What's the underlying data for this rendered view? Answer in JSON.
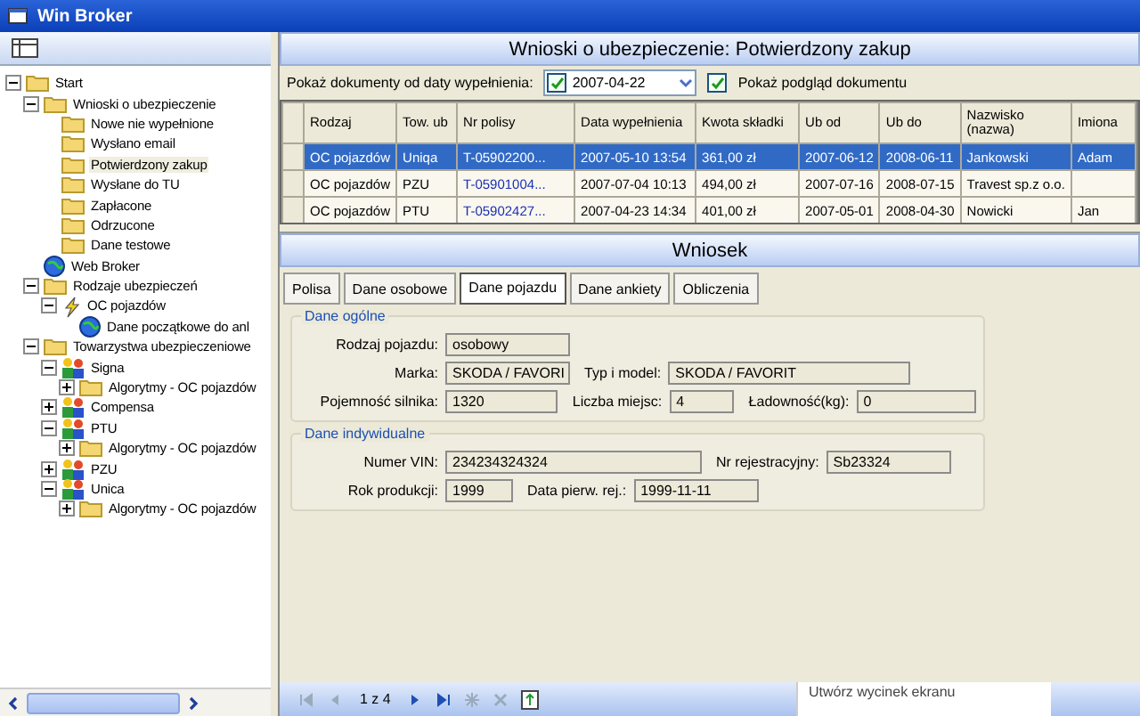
{
  "window": {
    "title": "Win Broker"
  },
  "tree": [
    {
      "label": "Start",
      "kind": "folder",
      "expanded": true,
      "selected": false,
      "children": [
        {
          "label": "Wnioski o ubezpieczenie",
          "kind": "folder",
          "expanded": true,
          "selected": false,
          "children": [
            {
              "label": "Nowe nie wypełnione",
              "kind": "folder",
              "selected": false
            },
            {
              "label": "Wysłano email",
              "kind": "folder",
              "selected": false
            },
            {
              "label": "Potwierdzony zakup",
              "kind": "folder",
              "selected": true
            },
            {
              "label": "Wysłane do TU",
              "kind": "folder",
              "selected": false
            },
            {
              "label": "Zapłacone",
              "kind": "folder",
              "selected": false
            },
            {
              "label": "Odrzucone",
              "kind": "folder",
              "selected": false
            },
            {
              "label": "Dane testowe",
              "kind": "folder",
              "selected": false
            }
          ]
        },
        {
          "label": "Web Broker",
          "kind": "globe",
          "selected": false
        },
        {
          "label": "Rodzaje ubezpieczeń",
          "kind": "folder",
          "expanded": true,
          "selected": false,
          "children": [
            {
              "label": "OC pojazdów",
              "kind": "bolt",
              "expanded": true,
              "selected": false,
              "children": [
                {
                  "label": "Dane początkowe do anl",
                  "kind": "globe",
                  "selected": false
                }
              ]
            }
          ]
        },
        {
          "label": "Towarzystwa ubezpieczeniowe",
          "kind": "folder",
          "expanded": true,
          "selected": false,
          "children": [
            {
              "label": "Signa",
              "kind": "company",
              "expanded": true,
              "selected": false,
              "children": [
                {
                  "label": "Algorytmy - OC pojazdów",
                  "kind": "folder",
                  "expanded": false,
                  "selected": false
                }
              ]
            },
            {
              "label": "Compensa",
              "kind": "company",
              "expanded": false,
              "selected": false
            },
            {
              "label": "PTU",
              "kind": "company",
              "expanded": true,
              "selected": false,
              "children": [
                {
                  "label": "Algorytmy - OC pojazdów",
                  "kind": "folder",
                  "expanded": false,
                  "selected": false
                }
              ]
            },
            {
              "label": "PZU",
              "kind": "company",
              "expanded": false,
              "selected": false
            },
            {
              "label": "Unica",
              "kind": "company",
              "expanded": true,
              "selected": false,
              "children": [
                {
                  "label": "Algorytmy - OC pojazdów",
                  "kind": "folder",
                  "expanded": false,
                  "selected": false
                }
              ]
            }
          ]
        }
      ]
    }
  ],
  "list_header": {
    "title": "Wnioski o ubezpieczenie: Potwierdzony zakup"
  },
  "filter": {
    "label": "Pokaż dokumenty od daty wypełnienia:",
    "date": {
      "checked": true,
      "value": "2007-04-22"
    },
    "preview": {
      "checked": true,
      "label": "Pokaż podgląd dokumentu"
    }
  },
  "table": {
    "columns": [
      "Rodzaj",
      "Tow. ub",
      "Nr polisy",
      "Data wypełnienia",
      "Kwota składki",
      "Ub od",
      "Ub do",
      "Nazwisko (nazwa)",
      "Imiona"
    ],
    "rows": [
      {
        "selected": true,
        "cells": [
          "OC pojazdów",
          "Uniqa",
          "T-05902200...",
          "2007-05-10 13:54",
          "361,00 zł",
          "2007-06-12",
          "2008-06-11",
          "Jankowski",
          "Adam"
        ]
      },
      {
        "selected": false,
        "cells": [
          "OC pojazdów",
          "PZU",
          "T-05901004...",
          "2007-07-04 10:13",
          "494,00 zł",
          "2007-07-16",
          "2008-07-15",
          "Travest sp.z o.o.",
          ""
        ]
      },
      {
        "selected": false,
        "cells": [
          "OC pojazdów",
          "PTU",
          "T-05902427...",
          "2007-04-23 14:34",
          "401,00 zł",
          "2007-05-01",
          "2008-04-30",
          "Nowicki",
          "Jan"
        ]
      }
    ]
  },
  "detail_header": {
    "title": "Wniosek"
  },
  "tabs": [
    {
      "label": "Polisa",
      "selected": false
    },
    {
      "label": "Dane osobowe",
      "selected": false
    },
    {
      "label": "Dane pojazdu",
      "selected": true
    },
    {
      "label": "Dane ankiety",
      "selected": false
    },
    {
      "label": "Obliczenia",
      "selected": false
    }
  ],
  "groups": [
    {
      "title": "Dane ogólne",
      "rows": [
        [
          {
            "label": "Rodzaj pojazdu:",
            "value": "osobowy"
          }
        ],
        [
          {
            "label": "Marka:",
            "value": "SKODA / FAVORI"
          },
          {
            "label": "Typ i model:",
            "value": "SKODA / FAVORIT"
          }
        ],
        [
          {
            "label": "Pojemność silnika:",
            "value": "1320"
          },
          {
            "label": "Liczba miejsc:",
            "value": "4"
          },
          {
            "label": "Ładowność(kg):",
            "value": "0"
          }
        ]
      ]
    },
    {
      "title": "Dane indywidualne",
      "rows": [
        [
          {
            "label": "Numer VIN:",
            "value": "234234324324"
          },
          {
            "label": "Nr rejestracyjny:",
            "value": "Sb23324"
          }
        ],
        [
          {
            "label": "Rok produkcji:",
            "value": "1999"
          },
          {
            "label": "Data pierw. rej.:",
            "value": "1999-11-11"
          }
        ]
      ]
    }
  ],
  "navigator": {
    "position": "1 z 4"
  },
  "tooltip": {
    "text": "Utwórz wycinek ekranu"
  }
}
